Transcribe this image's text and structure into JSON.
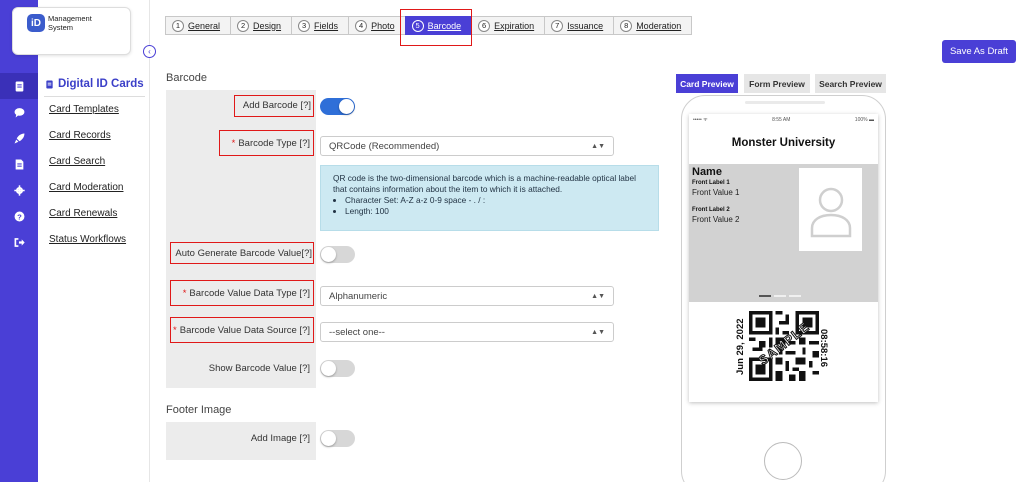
{
  "app": {
    "logo_mark": "iD",
    "logo_text": "Management System"
  },
  "rail": {
    "icons": [
      "id-card-icon",
      "chat-icon",
      "rocket-icon",
      "document-icon",
      "gear-icon",
      "help-icon",
      "sign-out-icon"
    ]
  },
  "subnav": {
    "title": "Digital ID Cards",
    "items": [
      "Card Templates",
      "Card Records",
      "Card Search",
      "Card Moderation",
      "Card Renewals",
      "Status Workflows"
    ]
  },
  "stepper": {
    "steps": [
      {
        "num": "1",
        "label": "General"
      },
      {
        "num": "2",
        "label": "Design"
      },
      {
        "num": "3",
        "label": "Fields"
      },
      {
        "num": "4",
        "label": "Photo"
      },
      {
        "num": "5",
        "label": "Barcode"
      },
      {
        "num": "6",
        "label": "Expiration"
      },
      {
        "num": "7",
        "label": "Issuance"
      },
      {
        "num": "8",
        "label": "Moderation"
      }
    ],
    "active": "Barcode"
  },
  "toolbar": {
    "save_label": "Save As Draft"
  },
  "barcode": {
    "section_title": "Barcode",
    "add_barcode_label": "Add Barcode [?]",
    "add_barcode_on": true,
    "type_label": "Barcode Type [?]",
    "type_value": "QRCode (Recommended)",
    "info_text": "QR code is the two-dimensional barcode which is a machine-readable optical label that contains information about the item to which it is attached.",
    "info_bullets": [
      "Character Set: A-Z a-z 0-9 space - . / :",
      "Length: 100"
    ],
    "auto_generate_label": "Auto Generate Barcode Value[?]",
    "auto_generate_on": false,
    "data_type_label": "Barcode Value Data Type [?]",
    "data_type_value": "Alphanumeric",
    "data_source_label": "Barcode Value Data Source [?]",
    "data_source_value": "--select one--",
    "show_value_label": "Show Barcode Value [?]",
    "show_value_on": false,
    "required_mark": "*"
  },
  "footer_image": {
    "section_title": "Footer Image",
    "add_image_label": "Add Image [?]",
    "add_image_on": false
  },
  "preview": {
    "tabs": [
      "Card Preview",
      "Form Preview",
      "Search Preview"
    ],
    "active_tab": "Card Preview",
    "status_left": "••••• ᯤ",
    "status_time": "8:55 AM",
    "status_battery": "100% ▬",
    "university": "Monster University",
    "name": "Name",
    "front_label_1": "Front Label 1",
    "front_value_1": "Front Value 1",
    "front_label_2": "Front Label 2",
    "front_value_2": "Front Value 2",
    "date": "Jun 29, 2022",
    "time": "08:58:16",
    "watermark": "SAMPLE"
  }
}
